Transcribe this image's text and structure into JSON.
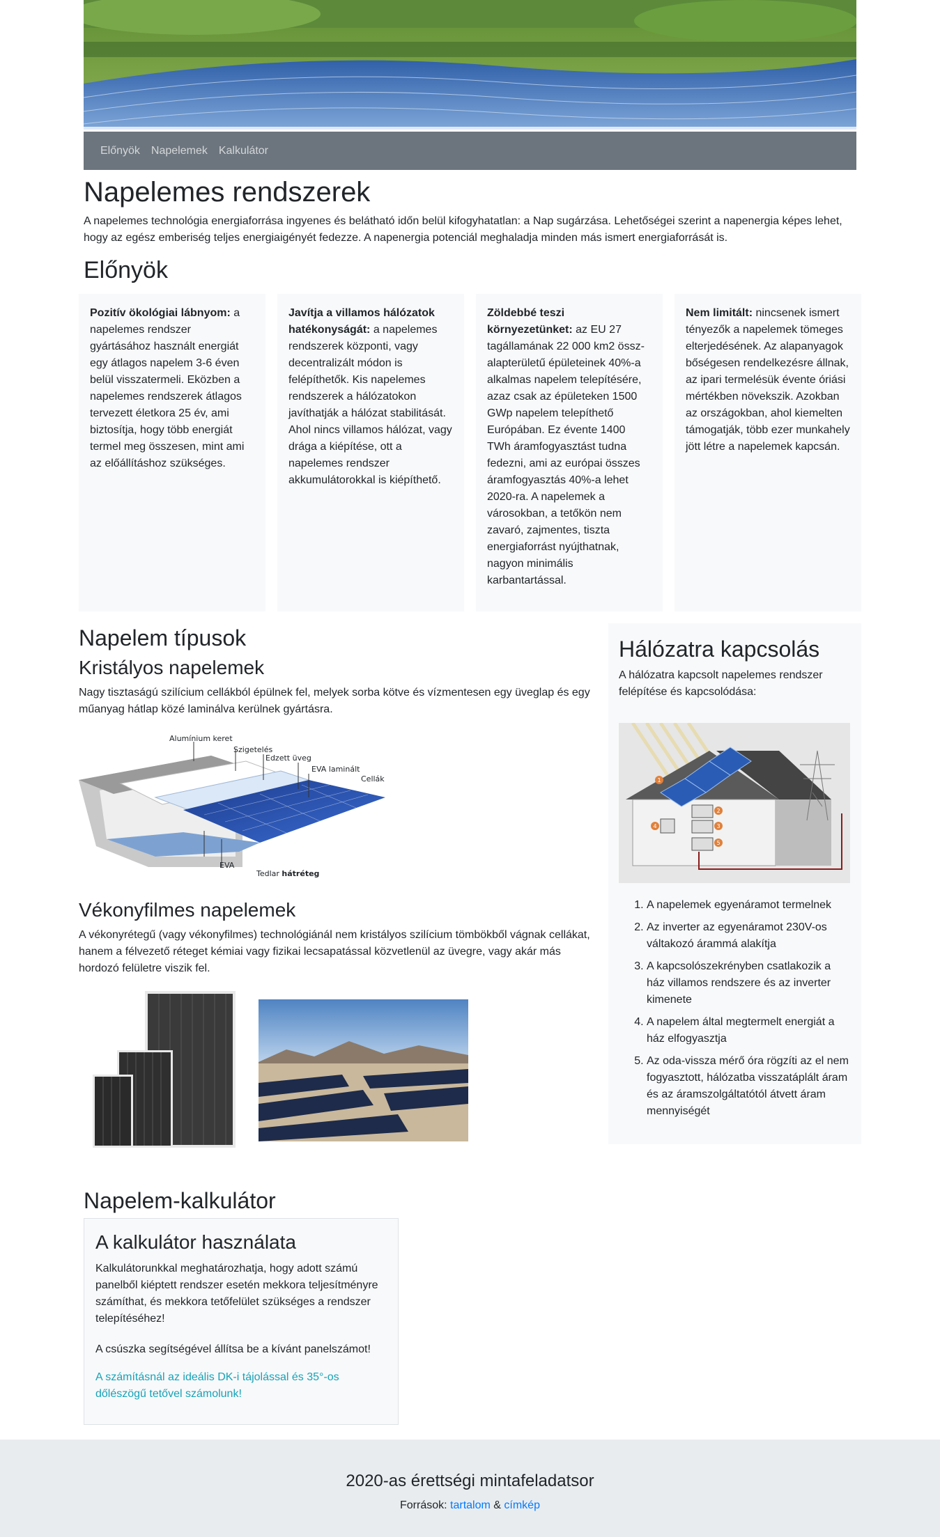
{
  "nav": {
    "items": [
      "Előnyök",
      "Napelemek",
      "Kalkulátor"
    ]
  },
  "intro": {
    "title": "Napelemes rendszerek",
    "text": "A napelemes technológia energiaforrása ingyenes és belátható időn belül kifogyhatatlan: a Nap sugárzása. Lehetőségei szerint a napenergia képes lehet, hogy az egész emberiség teljes energiaigényét fedezze. A napenergia potenciál meghaladja minden más ismert energiaforrását is."
  },
  "advantages": {
    "heading": "Előnyök",
    "cards": [
      {
        "bold": "Pozitív ökológiai lábnyom:",
        "text": " a napelemes rendszer gyártásához használt energiát egy átlagos napelem 3-6 éven belül visszatermeli. Eközben a napelemes rendszerek átlagos tervezett életkora 25 év, ami biztosítja, hogy több energiát termel meg összesen, mint ami az előállításhoz szükséges."
      },
      {
        "bold": "Javítja a villamos hálózatok hatékonyságát:",
        "text": " a napelemes rendszerek központi, vagy decentralizált módon is felépíthetők. Kis napelemes rendszerek a hálózatokon javíthatják a hálózat stabilitását. Ahol nincs villamos hálózat, vagy drága a kiépítése, ott a napelemes rendszer akkumulátorokkal is kiépíthető."
      },
      {
        "bold": "Zöldebbé teszi környezetünket:",
        "text": " az EU 27 tagállamának 22 000 km2 össz-alapterületű épületeinek 40%-a alkalmas napelem telepítésére, azaz csak az épületeken 1500 GWp napelem telepíthető Európában. Ez évente 1400 TWh áramfogyasztást tudna fedezni, ami az európai összes áramfogyasztás 40%-a lehet 2020-ra. A napelemek a városokban, a tetőkön nem zavaró, zajmentes, tiszta energiaforrást nyújthatnak, nagyon minimális karbantartással."
      },
      {
        "bold": "Nem limitált:",
        "text": " nincsenek ismert tényezők a napelemek tömeges elterjedésének. Az alapanyagok bőségesen rendelkezésre állnak, az ipari termelésük évente óriási mértékben növekszik. Azokban az országokban, ahol kiemelten támogatják, több ezer munkahely jött létre a napelemek kapcsán."
      }
    ]
  },
  "types": {
    "heading": "Napelem típusok",
    "crystal": {
      "heading": "Kristályos napelemek",
      "text": "Nagy tisztaságú szilícium cellákból épülnek fel, melyek sorba kötve és vízmentesen egy üveglap és egy műanyag hátlap közé laminálva kerülnek gyártásra.",
      "labels": [
        "Alumínium keret",
        "Szigetelés",
        "Edzett üveg",
        "EVA laminált",
        "Cellák",
        "EVA",
        "Tedlar"
      ],
      "label_bold": "hátréteg"
    },
    "thin": {
      "heading": "Vékonyfilmes napelemek",
      "text": "A vékonyrétegű (vagy vékonyfilmes) technológiánál nem kristályos szilícium tömbökből vágnak cellákat, hanem a félvezető réteget kémiai vagy fizikai lecsapatással közvetlenül az üvegre, vagy akár más hordozó felületre viszik fel."
    }
  },
  "grid": {
    "heading": "Hálózatra kapcsolás",
    "text": "A hálózatra kapcsolt napelemes rendszer felépítése és kapcsolódása:",
    "markers": [
      "1",
      "2",
      "3",
      "4",
      "5"
    ],
    "steps": [
      "A napelemek egyenáramot termelnek",
      "Az inverter az egyenáramot 230V-os váltakozó árammá alakítja",
      "A kapcsolószekrényben csatlakozik a ház villamos rendszere és az inverter kimenete",
      "A napelem által megtermelt energiát a ház elfogyasztja",
      "Az oda-vissza mérő óra rögzíti az el nem fogyasztott, hálózatba visszatáplált áram és az áramszolgáltatótól átvett áram mennyiségét"
    ]
  },
  "calculator": {
    "heading": "Napelem-kalkulátor",
    "card_title": "A kalkulátor használata",
    "p1": "Kalkulátorunkkal meghatározhatja, hogy adott számú panelből kiéptett rendszer esetén mekkora teljesítményre számíthat, és mekkora tetőfelület szükséges a rendszer telepítéséhez!",
    "p2": "A csúszka segítségével állítsa be a kívánt panelszámot!",
    "p3": "A számításnál az ideális DK-i tájolással és 35°-os dőlészögű tetővel számolunk!"
  },
  "footer": {
    "title": "2020-as érettségi mintafeladatsor",
    "sources_label": "Források:",
    "link1": "tartalom",
    "amp": "&",
    "link2": "címkép"
  }
}
